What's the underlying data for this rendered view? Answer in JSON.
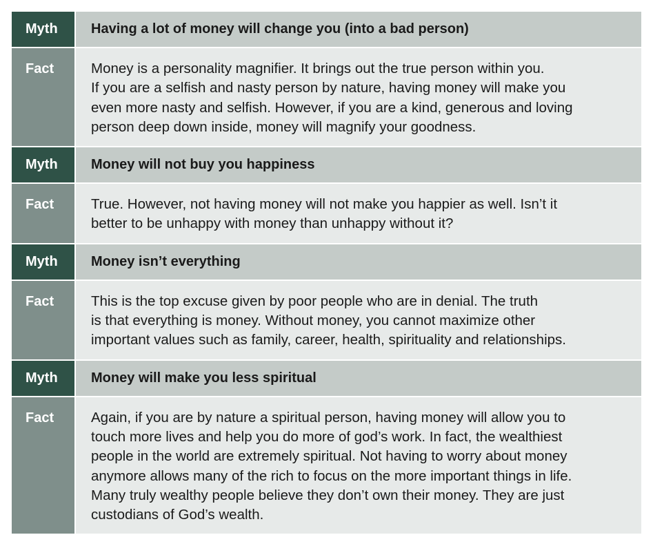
{
  "rows": [
    {
      "myth_label": "Myth",
      "myth": "Having a lot of money will change you (into a bad person)",
      "fact_label": "Fact",
      "fact_lines": [
        "Money is a personality magnifier. It brings out the true person within you.",
        "If you are a selfish and nasty person by nature, having money will make you",
        "even more nasty and selfish. However, if you are a kind, generous and loving",
        "person deep down inside, money will magnify your goodness."
      ]
    },
    {
      "myth_label": "Myth",
      "myth": "Money will not buy you happiness",
      "fact_label": "Fact",
      "fact_lines": [
        "True. However, not having money will not make you happier as well. Isn’t it",
        "better to be unhappy with money than unhappy without it?"
      ]
    },
    {
      "myth_label": "Myth",
      "myth": "Money isn’t everything",
      "fact_label": "Fact",
      "fact_lines": [
        "This is the top excuse given by poor people who are in denial. The truth",
        "is that everything is money. Without money, you cannot maximize other",
        "important values such as family, career, health, spirituality and relationships."
      ]
    },
    {
      "myth_label": "Myth",
      "myth": "Money will make you less spiritual",
      "fact_label": "Fact",
      "fact_lines": [
        "Again, if you are by nature a spiritual person, having money will allow you to",
        "touch more lives and help you do more of god’s work. In fact, the wealthiest",
        "people in the world are extremely spiritual. Not having to worry about money",
        "anymore allows many of the rich to focus on the more important things in life.",
        "Many truly wealthy people believe they don’t own their money. They are just",
        "custodians of God’s wealth."
      ]
    }
  ]
}
